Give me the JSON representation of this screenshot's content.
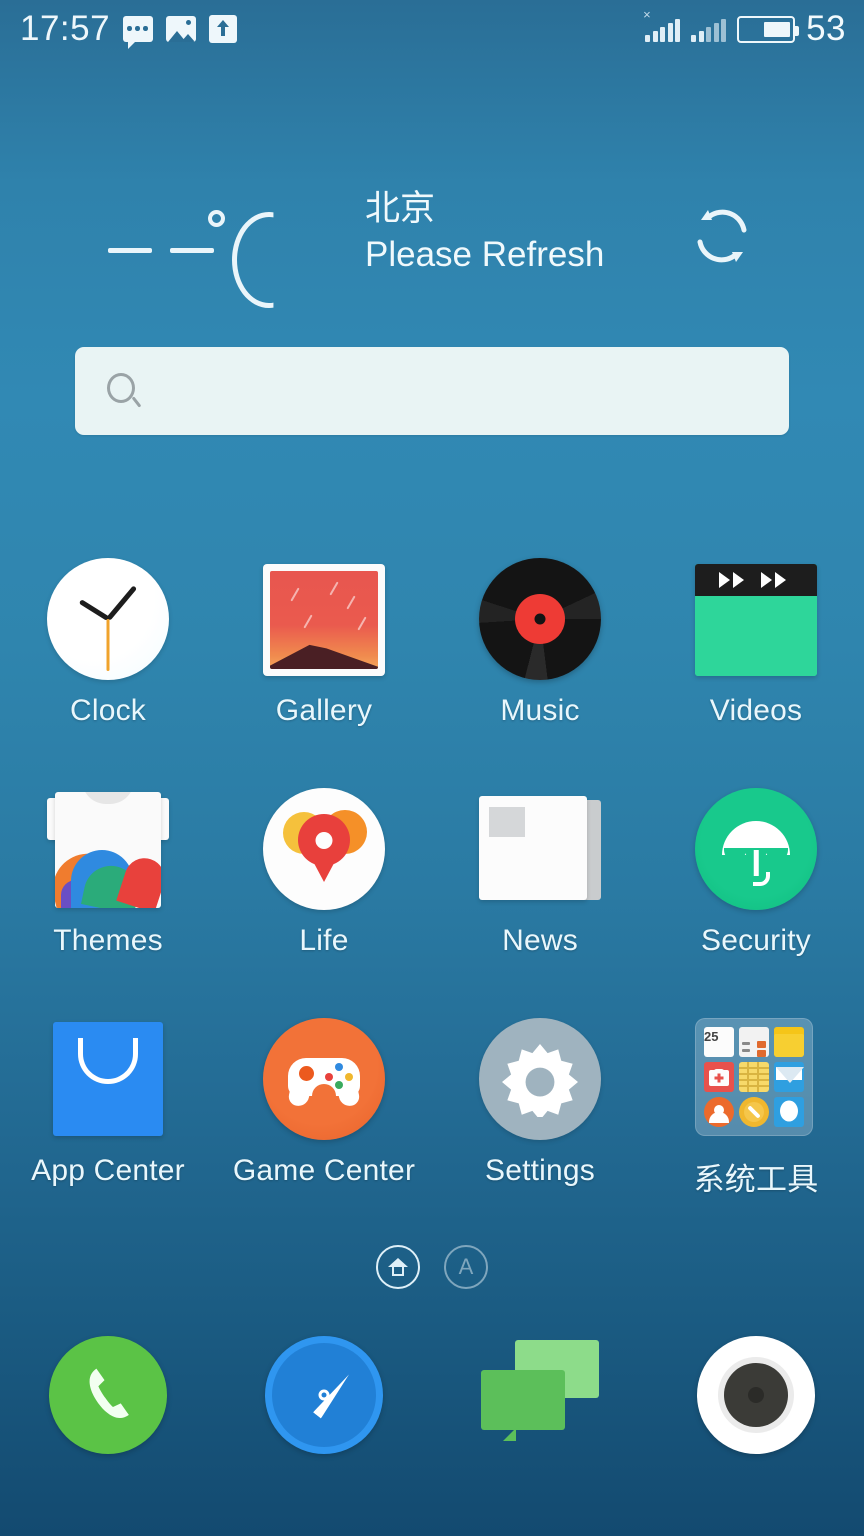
{
  "status_bar": {
    "time": "17:57",
    "battery_percent": "53",
    "notification_icons": [
      "message-bubble-icon",
      "photo-icon",
      "upload-arrow-icon"
    ],
    "signal_icons": [
      "signal-bars-no-service-icon",
      "signal-bars-icon"
    ],
    "battery_icon": "battery-icon"
  },
  "weather_widget": {
    "temperature": "- -",
    "unit": "°C",
    "city": "北京",
    "status": "Please Refresh",
    "refresh_icon": "refresh-icon"
  },
  "search": {
    "value": "",
    "placeholder": "",
    "icon": "search-icon"
  },
  "app_grid": {
    "rows": [
      [
        {
          "label": "Clock",
          "icon": "clock-icon"
        },
        {
          "label": "Gallery",
          "icon": "gallery-icon"
        },
        {
          "label": "Music",
          "icon": "music-icon"
        },
        {
          "label": "Videos",
          "icon": "videos-icon"
        }
      ],
      [
        {
          "label": "Themes",
          "icon": "themes-icon"
        },
        {
          "label": "Life",
          "icon": "life-icon"
        },
        {
          "label": "News",
          "icon": "news-icon"
        },
        {
          "label": "Security",
          "icon": "security-icon"
        }
      ],
      [
        {
          "label": "App Center",
          "icon": "app-center-icon"
        },
        {
          "label": "Game Center",
          "icon": "game-center-icon"
        },
        {
          "label": "Settings",
          "icon": "settings-icon"
        },
        {
          "label": "系统工具",
          "icon": "system-tools-folder-icon"
        }
      ]
    ],
    "folder_contents": [
      "calendar-icon",
      "calculator-icon",
      "file-manager-icon",
      "toolbox-icon",
      "notes-icon",
      "email-icon",
      "contacts-icon",
      "compass-icon",
      "weather-icon"
    ],
    "calendar_day": "25"
  },
  "page_indicator": {
    "dots": [
      {
        "icon": "home-icon",
        "active": true
      },
      {
        "label": "A",
        "active": false
      }
    ]
  },
  "dock": [
    {
      "label": "Phone",
      "icon": "phone-icon"
    },
    {
      "label": "Browser",
      "icon": "browser-compass-icon"
    },
    {
      "label": "Messages",
      "icon": "messages-icon"
    },
    {
      "label": "Camera",
      "icon": "camera-icon"
    }
  ],
  "colors": {
    "background_top": "#2a6e96",
    "background_bottom": "#134a70",
    "label_text": "#e9f7fc",
    "search_bar": "#e9f4f4",
    "accent_red": "#e8403c",
    "accent_green": "#18c98c",
    "accent_blue": "#2a8bf2",
    "accent_orange": "#f27238"
  }
}
